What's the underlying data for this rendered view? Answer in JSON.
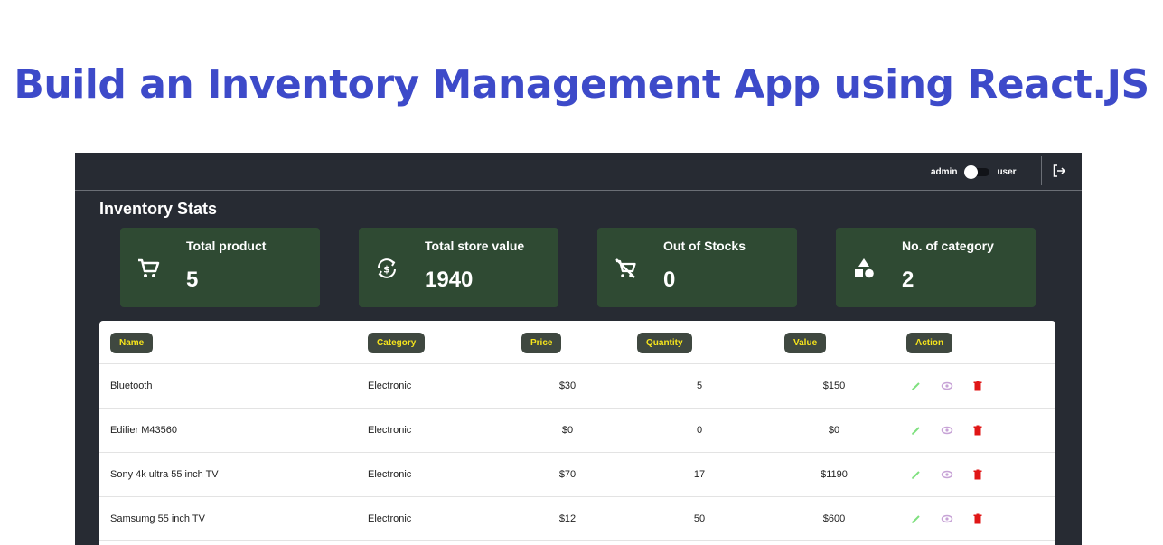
{
  "headline": "Build an Inventory Management App using React.JS",
  "header": {
    "role_left": "admin",
    "role_right": "user"
  },
  "stats": {
    "title": "Inventory Stats",
    "cards": [
      {
        "label": "Total product",
        "value": "5",
        "icon": "cart-icon"
      },
      {
        "label": "Total store value",
        "value": "1940",
        "icon": "currency-exchange-icon"
      },
      {
        "label": "Out of Stocks",
        "value": "0",
        "icon": "remove-cart-icon"
      },
      {
        "label": "No. of category",
        "value": "2",
        "icon": "shapes-icon"
      }
    ]
  },
  "table": {
    "headers": [
      "Name",
      "Category",
      "Price",
      "Quantity",
      "Value",
      "Action"
    ],
    "rows": [
      {
        "name": "Bluetooth",
        "category": "Electronic",
        "price": "$30",
        "quantity": "5",
        "value": "$150"
      },
      {
        "name": "Edifier M43560",
        "category": "Electronic",
        "price": "$0",
        "quantity": "0",
        "value": "$0"
      },
      {
        "name": "Sony 4k ultra 55 inch TV",
        "category": "Electronic",
        "price": "$70",
        "quantity": "17",
        "value": "$1190"
      },
      {
        "name": "Samsumg 55 inch TV",
        "category": "Electronic",
        "price": "$12",
        "quantity": "50",
        "value": "$600"
      }
    ]
  },
  "colors": {
    "headline": "#3d4ac9",
    "app_bg": "#272b33",
    "card_bg": "#2f4a33",
    "header_pill_bg": "#3f4840",
    "header_pill_text": "#f6e41c",
    "edit": "#7ee07e",
    "view": "#c7a3d6",
    "delete": "#e01616"
  }
}
